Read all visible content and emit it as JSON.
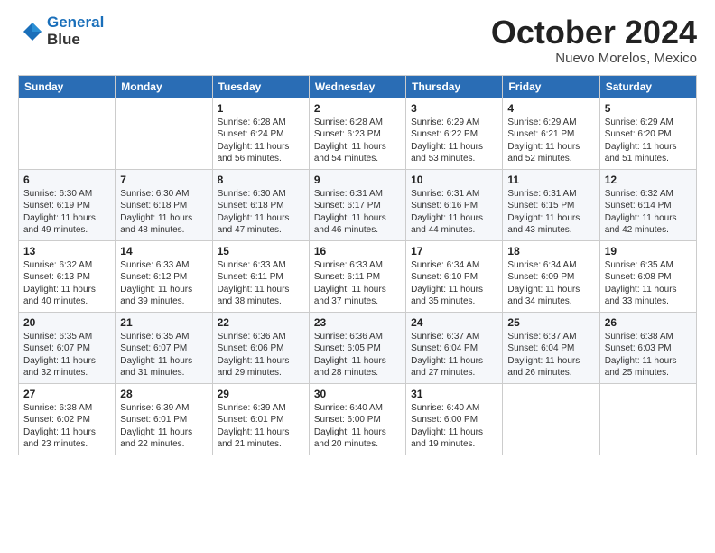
{
  "header": {
    "logo_line1": "General",
    "logo_line2": "Blue",
    "title": "October 2024",
    "location": "Nuevo Morelos, Mexico"
  },
  "weekdays": [
    "Sunday",
    "Monday",
    "Tuesday",
    "Wednesday",
    "Thursday",
    "Friday",
    "Saturday"
  ],
  "weeks": [
    [
      {
        "day": "",
        "info": ""
      },
      {
        "day": "",
        "info": ""
      },
      {
        "day": "1",
        "info": "Sunrise: 6:28 AM\nSunset: 6:24 PM\nDaylight: 11 hours and 56 minutes."
      },
      {
        "day": "2",
        "info": "Sunrise: 6:28 AM\nSunset: 6:23 PM\nDaylight: 11 hours and 54 minutes."
      },
      {
        "day": "3",
        "info": "Sunrise: 6:29 AM\nSunset: 6:22 PM\nDaylight: 11 hours and 53 minutes."
      },
      {
        "day": "4",
        "info": "Sunrise: 6:29 AM\nSunset: 6:21 PM\nDaylight: 11 hours and 52 minutes."
      },
      {
        "day": "5",
        "info": "Sunrise: 6:29 AM\nSunset: 6:20 PM\nDaylight: 11 hours and 51 minutes."
      }
    ],
    [
      {
        "day": "6",
        "info": "Sunrise: 6:30 AM\nSunset: 6:19 PM\nDaylight: 11 hours and 49 minutes."
      },
      {
        "day": "7",
        "info": "Sunrise: 6:30 AM\nSunset: 6:18 PM\nDaylight: 11 hours and 48 minutes."
      },
      {
        "day": "8",
        "info": "Sunrise: 6:30 AM\nSunset: 6:18 PM\nDaylight: 11 hours and 47 minutes."
      },
      {
        "day": "9",
        "info": "Sunrise: 6:31 AM\nSunset: 6:17 PM\nDaylight: 11 hours and 46 minutes."
      },
      {
        "day": "10",
        "info": "Sunrise: 6:31 AM\nSunset: 6:16 PM\nDaylight: 11 hours and 44 minutes."
      },
      {
        "day": "11",
        "info": "Sunrise: 6:31 AM\nSunset: 6:15 PM\nDaylight: 11 hours and 43 minutes."
      },
      {
        "day": "12",
        "info": "Sunrise: 6:32 AM\nSunset: 6:14 PM\nDaylight: 11 hours and 42 minutes."
      }
    ],
    [
      {
        "day": "13",
        "info": "Sunrise: 6:32 AM\nSunset: 6:13 PM\nDaylight: 11 hours and 40 minutes."
      },
      {
        "day": "14",
        "info": "Sunrise: 6:33 AM\nSunset: 6:12 PM\nDaylight: 11 hours and 39 minutes."
      },
      {
        "day": "15",
        "info": "Sunrise: 6:33 AM\nSunset: 6:11 PM\nDaylight: 11 hours and 38 minutes."
      },
      {
        "day": "16",
        "info": "Sunrise: 6:33 AM\nSunset: 6:11 PM\nDaylight: 11 hours and 37 minutes."
      },
      {
        "day": "17",
        "info": "Sunrise: 6:34 AM\nSunset: 6:10 PM\nDaylight: 11 hours and 35 minutes."
      },
      {
        "day": "18",
        "info": "Sunrise: 6:34 AM\nSunset: 6:09 PM\nDaylight: 11 hours and 34 minutes."
      },
      {
        "day": "19",
        "info": "Sunrise: 6:35 AM\nSunset: 6:08 PM\nDaylight: 11 hours and 33 minutes."
      }
    ],
    [
      {
        "day": "20",
        "info": "Sunrise: 6:35 AM\nSunset: 6:07 PM\nDaylight: 11 hours and 32 minutes."
      },
      {
        "day": "21",
        "info": "Sunrise: 6:35 AM\nSunset: 6:07 PM\nDaylight: 11 hours and 31 minutes."
      },
      {
        "day": "22",
        "info": "Sunrise: 6:36 AM\nSunset: 6:06 PM\nDaylight: 11 hours and 29 minutes."
      },
      {
        "day": "23",
        "info": "Sunrise: 6:36 AM\nSunset: 6:05 PM\nDaylight: 11 hours and 28 minutes."
      },
      {
        "day": "24",
        "info": "Sunrise: 6:37 AM\nSunset: 6:04 PM\nDaylight: 11 hours and 27 minutes."
      },
      {
        "day": "25",
        "info": "Sunrise: 6:37 AM\nSunset: 6:04 PM\nDaylight: 11 hours and 26 minutes."
      },
      {
        "day": "26",
        "info": "Sunrise: 6:38 AM\nSunset: 6:03 PM\nDaylight: 11 hours and 25 minutes."
      }
    ],
    [
      {
        "day": "27",
        "info": "Sunrise: 6:38 AM\nSunset: 6:02 PM\nDaylight: 11 hours and 23 minutes."
      },
      {
        "day": "28",
        "info": "Sunrise: 6:39 AM\nSunset: 6:01 PM\nDaylight: 11 hours and 22 minutes."
      },
      {
        "day": "29",
        "info": "Sunrise: 6:39 AM\nSunset: 6:01 PM\nDaylight: 11 hours and 21 minutes."
      },
      {
        "day": "30",
        "info": "Sunrise: 6:40 AM\nSunset: 6:00 PM\nDaylight: 11 hours and 20 minutes."
      },
      {
        "day": "31",
        "info": "Sunrise: 6:40 AM\nSunset: 6:00 PM\nDaylight: 11 hours and 19 minutes."
      },
      {
        "day": "",
        "info": ""
      },
      {
        "day": "",
        "info": ""
      }
    ]
  ]
}
